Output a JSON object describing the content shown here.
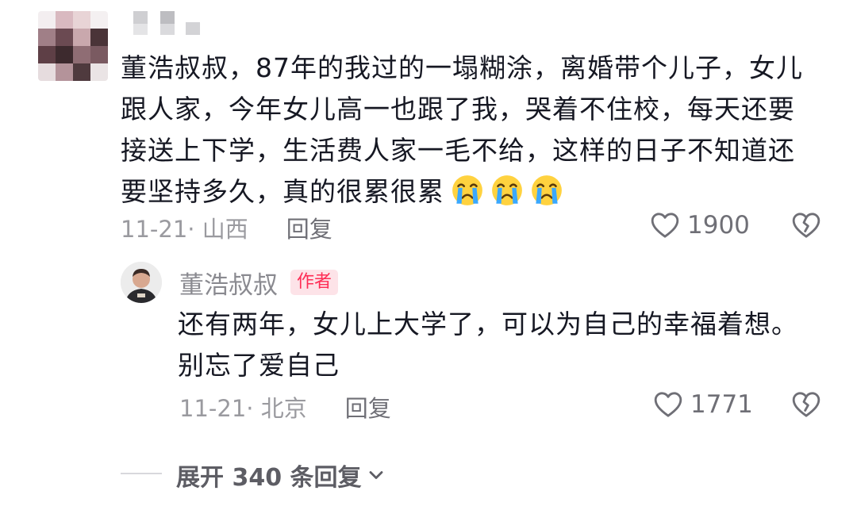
{
  "comment": {
    "text_before_emoji": "董浩叔叔，87年的我过的一塌糊涂，离婚带个儿子，女儿跟人家，今年女儿高一也跟了我，哭着不住校，每天还要接送上下学，生活费人家一毛不给，这样的日子不知道还要坚持多久，真的很累很累",
    "emojis": [
      "crying-emoji",
      "crying-emoji",
      "crying-emoji"
    ],
    "date_location": "11-21· 山西",
    "reply_label": "回复",
    "like_count": "1900"
  },
  "reply": {
    "author_name": "董浩叔叔",
    "author_badge": "作者",
    "text": "还有两年，女儿上大学了，可以为自己的幸福着想。别忘了爱自己",
    "date_location": "11-21· 北京",
    "reply_label": "回复",
    "like_count": "1771"
  },
  "expand": {
    "label": "展开 340 条回复"
  },
  "colors": {
    "text": "#161823",
    "meta": "#9a9a9f",
    "badge_bg": "#fde3e8",
    "badge_text": "#fe2c55"
  }
}
